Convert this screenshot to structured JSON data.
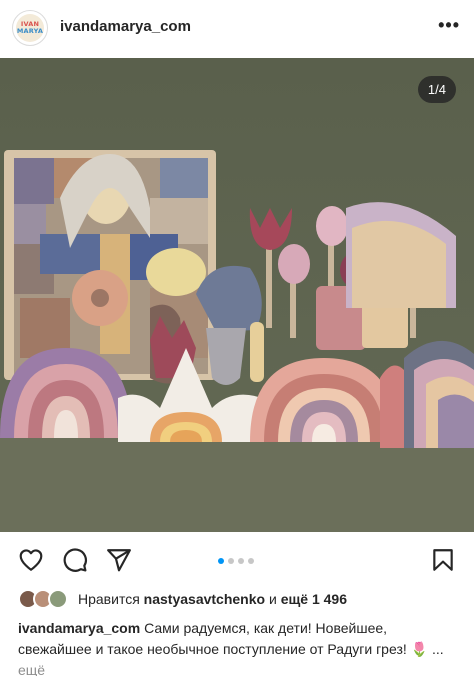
{
  "header": {
    "avatar_text_line1": "IVAN",
    "avatar_text_line2": "MARYA",
    "username": "ivandamarya_com",
    "more_label": "•••"
  },
  "photo": {
    "counter": "1/4"
  },
  "carousel": {
    "total": 4,
    "active_index": 0
  },
  "likes": {
    "prefix": "Нравится",
    "user": "nastyasavtchenko",
    "and_text": "и",
    "more_text": "ещё 1 496"
  },
  "caption": {
    "username": "ivandamarya_com",
    "text": "Сами радуемся, как дети! Новейшее, свежайшее и такое необычное поступление от Радуги грез!",
    "emoji": "🌷",
    "ellipsis": "...",
    "more": "ещё"
  },
  "icons": {
    "like": "heart-icon",
    "comment": "comment-icon",
    "share": "paper-plane-icon",
    "save": "bookmark-icon"
  },
  "colors": {
    "photo_background": "#5e634f",
    "accent": "#0095f6",
    "muted": "#8e8e8e",
    "text": "#262626"
  }
}
